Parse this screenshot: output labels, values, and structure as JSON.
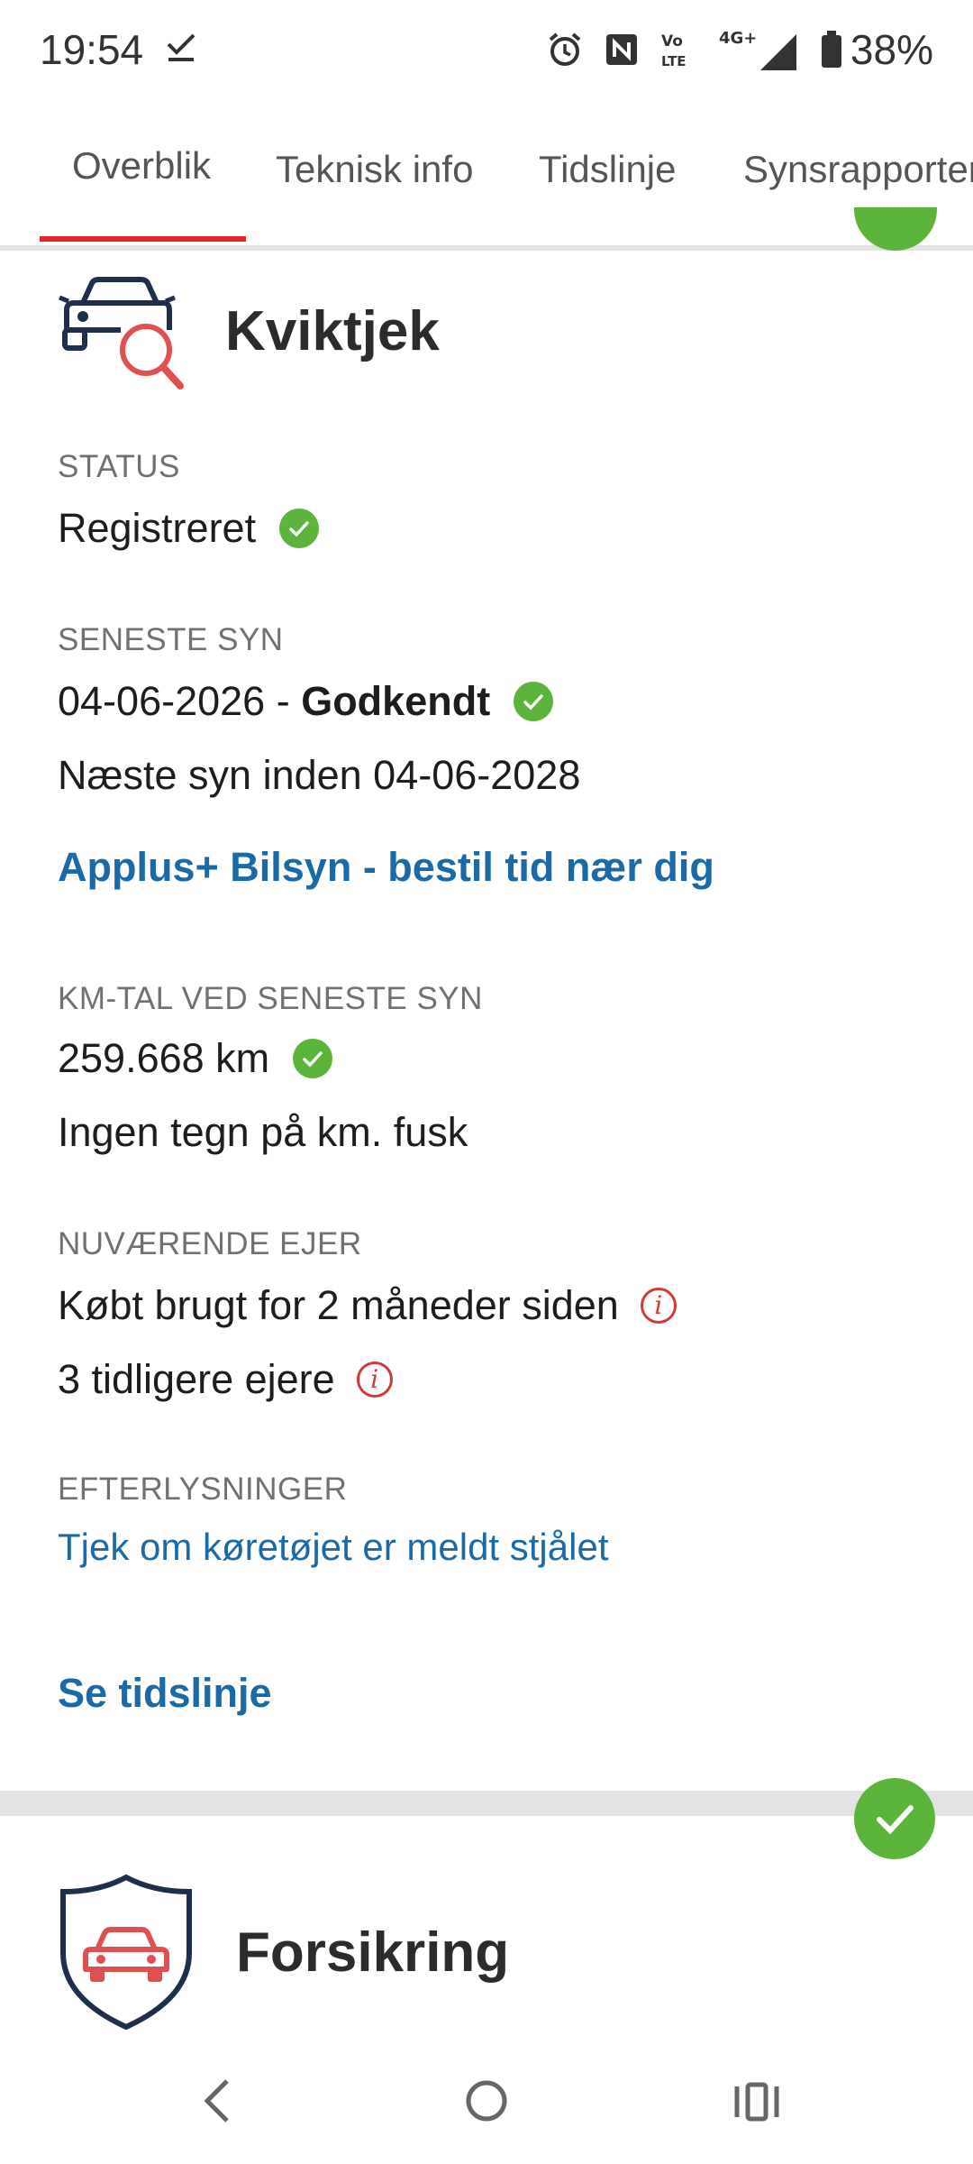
{
  "status_bar": {
    "time": "19:54",
    "battery": "38%",
    "icons": [
      "check-icon",
      "alarm-icon",
      "nfc-icon",
      "volte-icon",
      "signal-4g-icon",
      "battery-icon"
    ],
    "volte_top": "Vo",
    "volte_bottom": "LTE",
    "network_label": "4G+"
  },
  "tabs": [
    {
      "label": "Overblik",
      "active": true
    },
    {
      "label": "Teknisk info",
      "active": false
    },
    {
      "label": "Tidslinje",
      "active": false
    },
    {
      "label": "Synsrapporter",
      "active": false
    }
  ],
  "kviktjek": {
    "title": "Kviktjek",
    "status": {
      "label": "STATUS",
      "value": "Registreret"
    },
    "seneste_syn": {
      "label": "SENESTE SYN",
      "date": "04-06-2026",
      "separator": " - ",
      "result": "Godkendt",
      "next": "Næste syn inden 04-06-2028",
      "promo_link": "Applus+ Bilsyn - bestil tid nær dig"
    },
    "km": {
      "label": "KM-TAL VED SENESTE SYN",
      "value": "259.668 km",
      "note": "Ingen tegn på km. fusk"
    },
    "ejer": {
      "label": "NUVÆRENDE EJER",
      "bought": "Købt brugt for 2 måneder siden",
      "previous": "3 tidligere ejere"
    },
    "efterlysninger": {
      "label": "EFTERLYSNINGER",
      "link": "Tjek om køretøjet er meldt stjålet"
    },
    "timeline_link": "Se tidslinje"
  },
  "forsikring": {
    "title": "Forsikring"
  },
  "colors": {
    "accent_red": "#e0262b",
    "link_blue": "#1a6aa8",
    "success_green": "#5bb53a",
    "info_red": "#d23a3a"
  }
}
